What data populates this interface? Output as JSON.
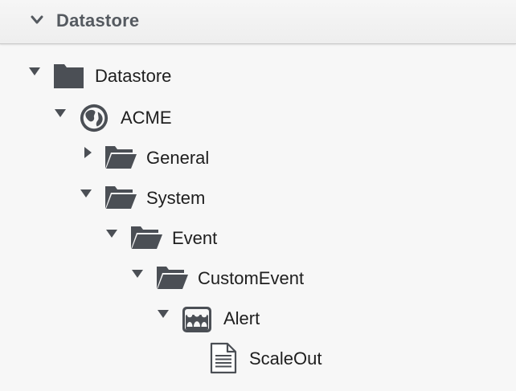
{
  "panel": {
    "title": "Datastore",
    "header_icon": "chevron-down-icon"
  },
  "tree": {
    "nodes": [
      {
        "label": "Datastore",
        "icon": "folder-icon",
        "expanded": true,
        "depth": 0
      },
      {
        "label": "ACME",
        "icon": "globe-icon",
        "expanded": true,
        "depth": 1
      },
      {
        "label": "General",
        "icon": "folder-open-icon",
        "expanded": false,
        "depth": 2
      },
      {
        "label": "System",
        "icon": "folder-open-icon",
        "expanded": true,
        "depth": 2
      },
      {
        "label": "Event",
        "icon": "folder-open-icon",
        "expanded": true,
        "depth": 3
      },
      {
        "label": "CustomEvent",
        "icon": "folder-open-icon",
        "expanded": true,
        "depth": 4
      },
      {
        "label": "Alert",
        "icon": "group-icon",
        "expanded": true,
        "depth": 5
      },
      {
        "label": "ScaleOut",
        "icon": "document-icon",
        "expanded": null,
        "depth": 6
      }
    ]
  },
  "colors": {
    "icon": "#4b4f55",
    "text": "#1e1e1e",
    "header_text": "#555a60",
    "background": "#f7f7f7"
  }
}
